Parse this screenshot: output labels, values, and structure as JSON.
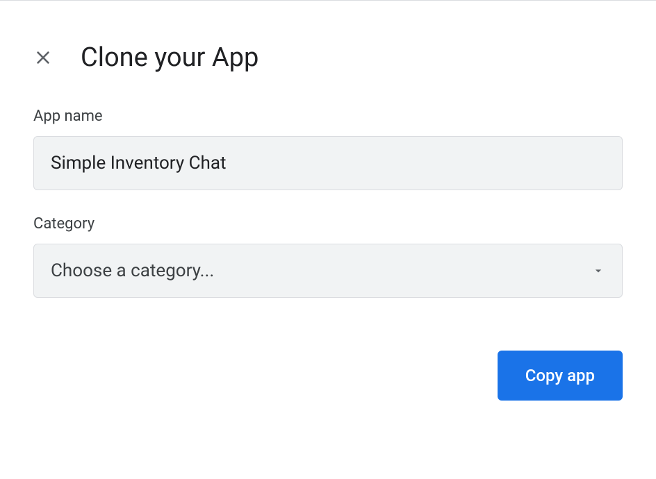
{
  "dialog": {
    "title": "Clone your App",
    "fields": {
      "app_name": {
        "label": "App name",
        "value": "Simple Inventory Chat"
      },
      "category": {
        "label": "Category",
        "placeholder": "Choose a category..."
      }
    },
    "actions": {
      "submit_label": "Copy app"
    }
  }
}
